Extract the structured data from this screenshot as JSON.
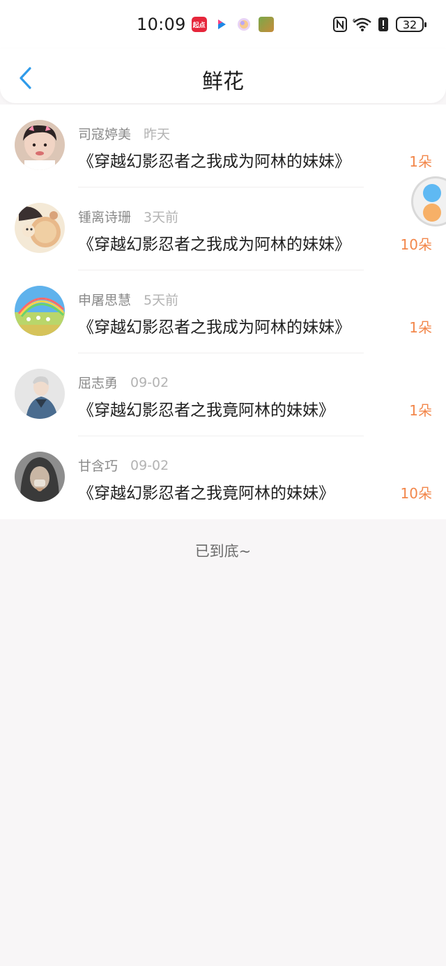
{
  "status_bar": {
    "time": "10:09",
    "app_badge_qidian": "起点",
    "battery": "32"
  },
  "header": {
    "title": "鲜花",
    "back_icon": "chevron-left-icon"
  },
  "items": [
    {
      "user": "司寇婷美",
      "time": "昨天",
      "book": "《穿越幻影忍者之我成为阿林的妹妹》",
      "count": "1朵",
      "avatar": "avatar-photo-1"
    },
    {
      "user": "锺离诗珊",
      "time": "3天前",
      "book": "《穿越幻影忍者之我成为阿林的妹妹》",
      "count": "10朵",
      "avatar": "avatar-photo-2"
    },
    {
      "user": "申屠思慧",
      "time": "5天前",
      "book": "《穿越幻影忍者之我成为阿林的妹妹》",
      "count": "1朵",
      "avatar": "avatar-photo-3"
    },
    {
      "user": "屈志勇",
      "time": "09-02",
      "book": "《穿越幻影忍者之我竟阿林的妹妹》",
      "count": "1朵",
      "avatar": "avatar-photo-4"
    },
    {
      "user": "甘含巧",
      "time": "09-02",
      "book": "《穿越幻影忍者之我竟阿林的妹妹》",
      "count": "10朵",
      "avatar": "avatar-photo-5"
    }
  ],
  "footer": {
    "end_text": "已到底~"
  },
  "colors": {
    "accent": "#2f9bea",
    "count": "#f2874b",
    "background": "#f8f6f7"
  }
}
